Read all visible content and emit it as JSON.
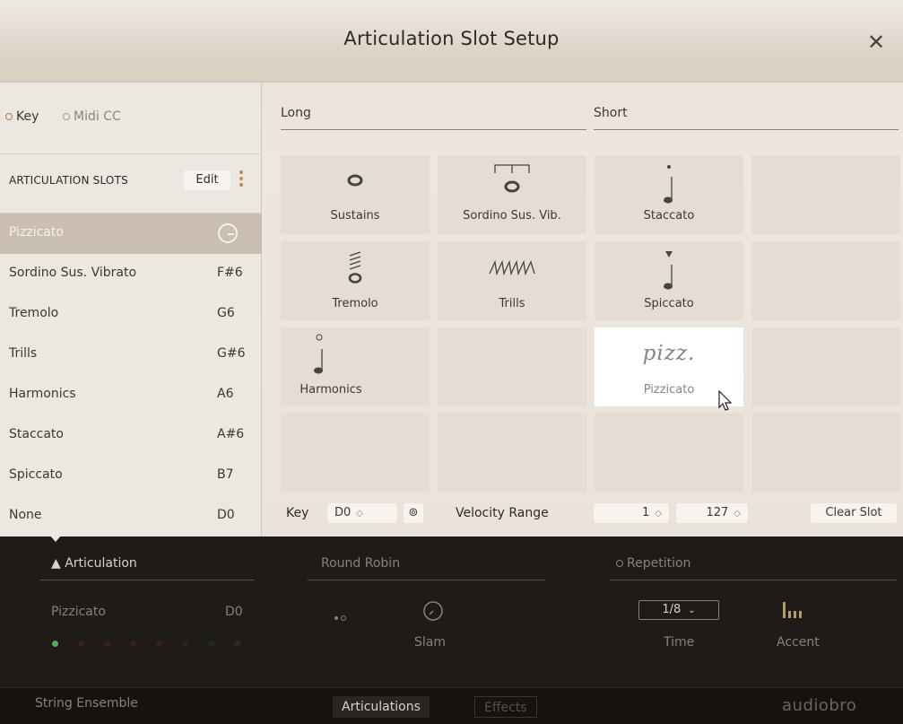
{
  "modal": {
    "title": "Articulation Slot Setup",
    "close": "✕"
  },
  "trigger": {
    "key": "Key",
    "midi": "Midi CC"
  },
  "slots": {
    "title": "ARTICULATION SLOTS",
    "edit": "Edit",
    "items": [
      {
        "name": "Pizzicato",
        "key": ""
      },
      {
        "name": "Sordino Sus. Vibrato",
        "key": "F#6"
      },
      {
        "name": "Tremolo",
        "key": "G6"
      },
      {
        "name": "Trills",
        "key": "G#6"
      },
      {
        "name": "Harmonics",
        "key": "A6"
      },
      {
        "name": "Staccato",
        "key": "A#6"
      },
      {
        "name": "Spiccato",
        "key": "B7"
      },
      {
        "name": "None",
        "key": "D0"
      }
    ]
  },
  "columns": {
    "long": "Long",
    "short": "Short"
  },
  "grid": {
    "sustains": "Sustains",
    "sordino": "Sordino Sus. Vib.",
    "staccato": "Staccato",
    "tremolo": "Tremolo",
    "trills": "Trills",
    "spiccato": "Spiccato",
    "harmonics": "Harmonics",
    "pizz_symbol": "pizz.",
    "pizzicato": "Pizzicato"
  },
  "keyrow": {
    "key_label": "Key",
    "key_value": "D0",
    "velocity_label": "Velocity Range",
    "vel_min": "1",
    "vel_max": "127",
    "clear": "Clear Slot"
  },
  "bottom": {
    "articulation": "▲ Articulation",
    "round_robin": "Round Robin",
    "repetition": "Repetition",
    "current_art": "Pizzicato",
    "current_key": "D0",
    "slam": "Slam",
    "time_value": "1/8",
    "time": "Time",
    "accent": "Accent"
  },
  "footer": {
    "instrument": "String Ensemble",
    "tab_art": "Articulations",
    "tab_eff": "Effects",
    "brand": "audiobro"
  },
  "colors": {
    "accent": "#c58a47",
    "led_on": "#4caf50",
    "led_off_red": "#3a1f1f",
    "led_off_green": "#1f2a1f"
  }
}
